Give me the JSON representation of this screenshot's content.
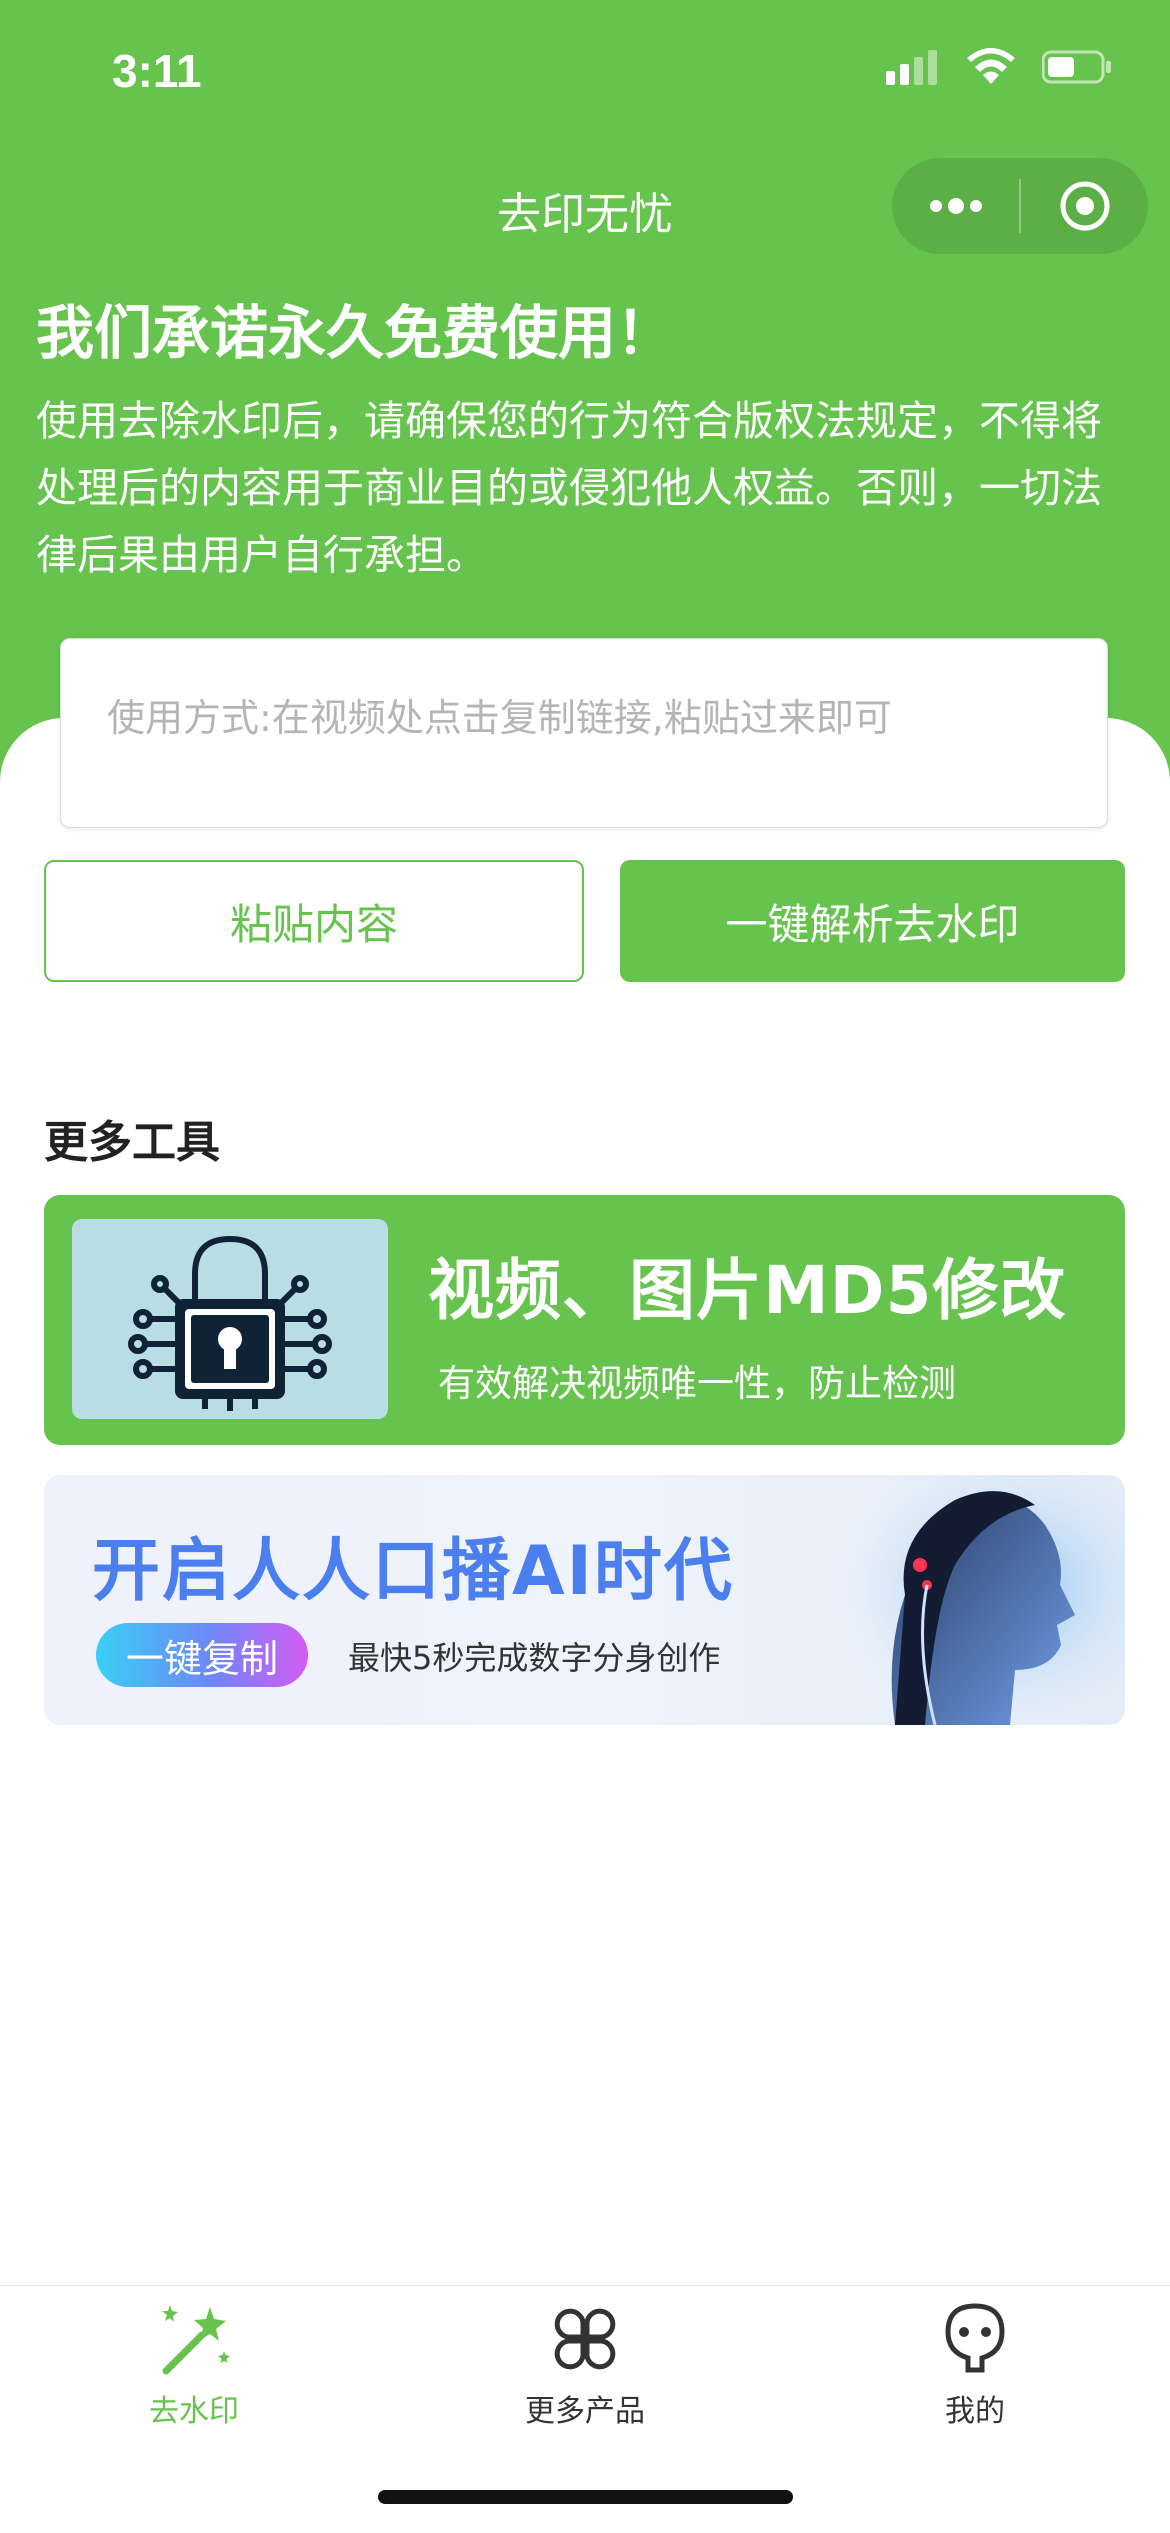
{
  "status_bar": {
    "time": "3:11"
  },
  "nav": {
    "title": "去印无忧"
  },
  "header": {
    "promise": "我们承诺永久免费使用！",
    "notice": "使用去除水印后，请确保您的行为符合版权法规定，不得将处理后的内容用于商业目的或侵犯他人权益。否则，一切法律后果由用户自行承担。"
  },
  "input": {
    "placeholder": "使用方式:在视频处点击复制链接,粘贴过来即可",
    "value": ""
  },
  "buttons": {
    "paste": "粘贴内容",
    "parse": "一键解析去水印"
  },
  "more_tools": {
    "title": "更多工具",
    "md5_card": {
      "title": "视频、图片MD5修改",
      "subtitle": "有效解决视频唯一性，防止检测",
      "icon": "padlock-circuit-icon"
    },
    "ai_card": {
      "title": "开启人人口播AI时代",
      "pill": "一键复制",
      "subtitle": "最快5秒完成数字分身创作"
    }
  },
  "tabbar": {
    "items": [
      {
        "label": "去水印",
        "icon": "magic-wand-icon",
        "active": true
      },
      {
        "label": "更多产品",
        "icon": "grid-clover-icon",
        "active": false
      },
      {
        "label": "我的",
        "icon": "profile-face-icon",
        "active": false
      }
    ]
  },
  "colors": {
    "brand_green": "#66c34d",
    "text_dark": "#222222",
    "placeholder": "#b5b5b5"
  }
}
